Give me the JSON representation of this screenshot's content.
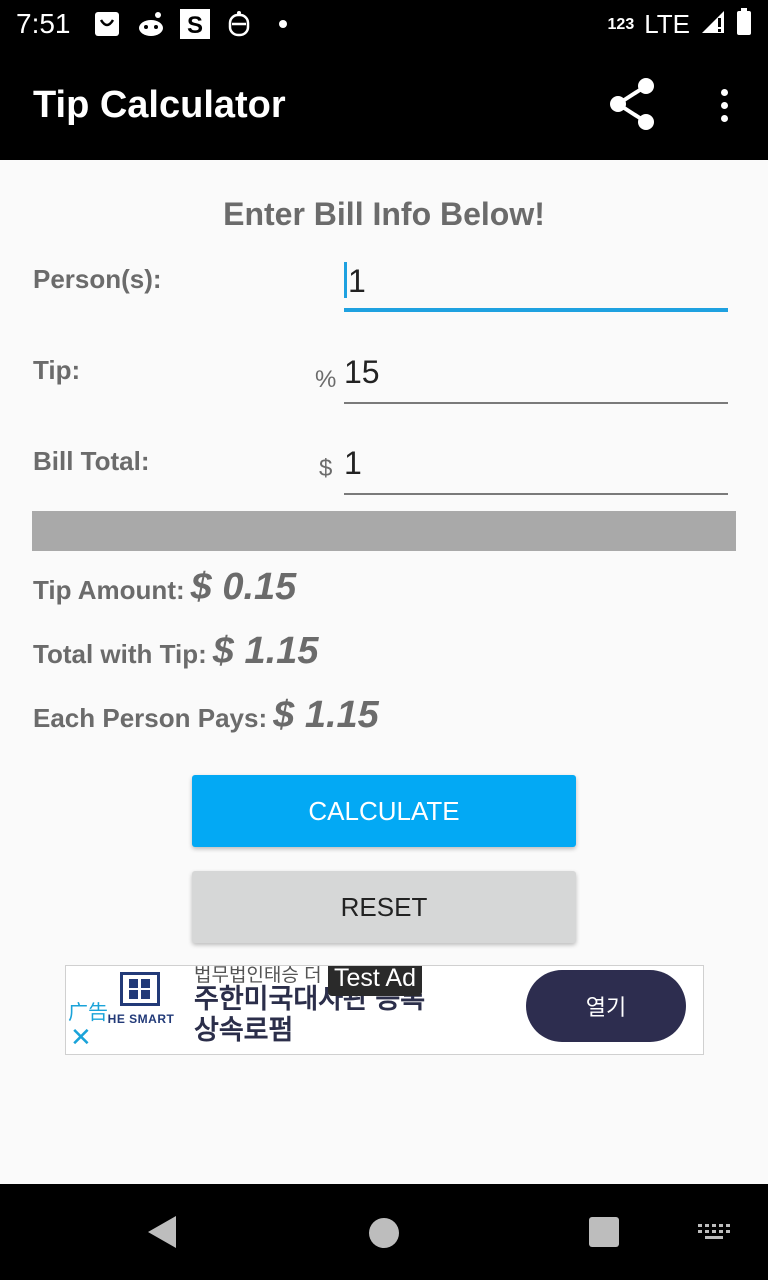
{
  "status_bar": {
    "time": "7:51",
    "network_label": "123",
    "network_type": "LTE",
    "icons": [
      "bag-icon",
      "reddit-icon",
      "s-app-icon",
      "bot-icon",
      "dot-icon",
      "signal-icon",
      "battery-icon"
    ]
  },
  "app_bar": {
    "title": "Tip Calculator",
    "share_icon": "share-icon",
    "menu_icon": "overflow-menu-icon"
  },
  "form": {
    "heading": "Enter Bill Info Below!",
    "persons_label": "Person(s):",
    "persons_value": "1",
    "tip_label": "Tip:",
    "tip_prefix": "%",
    "tip_value": "15",
    "bill_label": "Bill Total:",
    "bill_prefix": "$",
    "bill_value": "1"
  },
  "results": {
    "tip_amount_label": "Tip Amount:",
    "tip_amount_value": "$ 0.15",
    "total_label": "Total with Tip:",
    "total_value": "$ 1.15",
    "each_label": "Each Person Pays:",
    "each_value": "$ 1.15"
  },
  "buttons": {
    "calculate": "CALCULATE",
    "reset": "RESET"
  },
  "ad": {
    "tag": "广告",
    "badge": "Test Ad",
    "logo_text": "HE SMART",
    "small_text": "법무법인태승 더",
    "headline_1": "주한미국대사관 등록",
    "headline_2": "상속로펌",
    "cta": "열기"
  },
  "colors": {
    "accent": "#03a9f4",
    "focus_underline": "#1ea1e0",
    "text_gray": "#6b6b6b",
    "reset_bg": "#d6d7d7",
    "divider": "#a9a9a9"
  }
}
